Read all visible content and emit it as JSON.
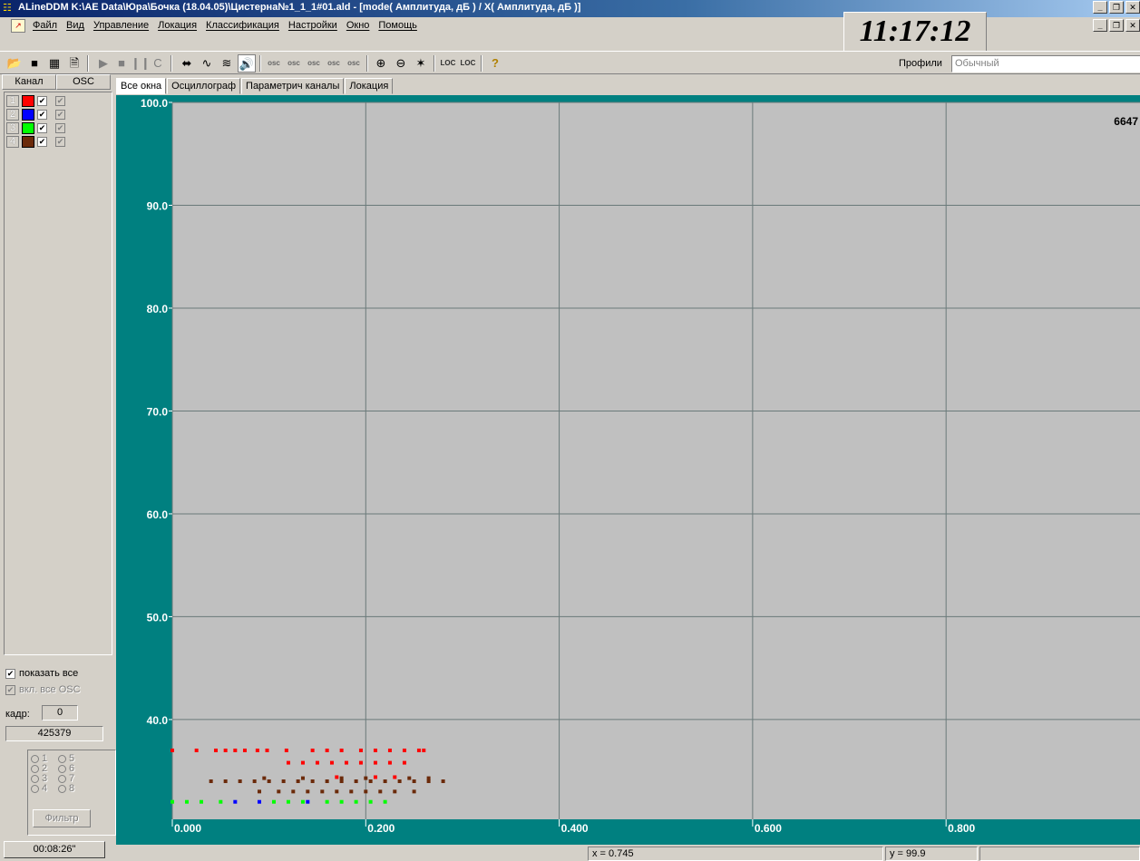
{
  "window": {
    "title": "ALineDDM K:\\AE Data\\Юра\\Бочка (18.04.05)\\Цистерна№1_1_1#01.ald - [mode( Амплитуда, дБ ) / X( Амплитуда, дБ )]",
    "icon": "app-logo-icon"
  },
  "menu": [
    "Файл",
    "Вид",
    "Управление",
    "Локация",
    "Классификация",
    "Настройки",
    "Окно",
    "Помощь"
  ],
  "clock": "11:17:12",
  "toolbar": {
    "profiles_label": "Профили",
    "profiles_value": "Обычный",
    "buttons": [
      "open-icon",
      "stop-square-icon",
      "table-icon",
      "document-icon",
      "play-icon",
      "stop-icon",
      "pause-icon",
      "c-icon",
      "plug-icon",
      "waveform-icon",
      "waveform-filter-icon",
      "speaker-icon",
      "osc-play-icon",
      "osc-stop-icon",
      "osc-record-icon",
      "osc-back-icon",
      "osc-forward-icon",
      "zoom-in-icon",
      "zoom-out-icon",
      "pin-icon",
      "loc-check-icon",
      "loc-refresh-icon",
      "help-icon"
    ],
    "osc_label": "osc",
    "loc_label": "LOC"
  },
  "left_panel": {
    "header_channel": "Канал",
    "header_osc": "OSC",
    "channels": [
      {
        "num": "1",
        "color": "#ff0000"
      },
      {
        "num": "2",
        "color": "#0000ff"
      },
      {
        "num": "3",
        "color": "#00ff00"
      },
      {
        "num": "4",
        "color": "#6b2a0a"
      }
    ],
    "show_all": "показать все",
    "enable_all_osc": "вкл. все OSC",
    "kadr_label": "кадр:",
    "kadr_value": "0",
    "count_value": "425379",
    "radios": [
      "1",
      "2",
      "3",
      "4",
      "5",
      "6",
      "7",
      "8"
    ],
    "filter_button": "Фильтр",
    "elapsed": "00:08:26\""
  },
  "tabs": [
    "Все окна",
    "Осциллограф",
    "Параметрич каналы",
    "Локация"
  ],
  "chart_data": {
    "type": "scatter",
    "count_label": "6647",
    "x_ticks": [
      "0.000",
      "0.200",
      "0.400",
      "0.600",
      "0.800"
    ],
    "y_ticks": [
      "100.0",
      "90.0",
      "80.0",
      "70.0",
      "60.0",
      "50.0",
      "40.0"
    ],
    "xlim": [
      0,
      1.0
    ],
    "ylim": [
      30.3,
      100.0
    ],
    "grid": true,
    "background": "#c0c0c0",
    "series": [
      {
        "color": "#ff0000",
        "points": [
          [
            0.0,
            37.0
          ],
          [
            0.025,
            37.0
          ],
          [
            0.045,
            37.0
          ],
          [
            0.055,
            37.0
          ],
          [
            0.065,
            37.0
          ],
          [
            0.075,
            37.0
          ],
          [
            0.088,
            37.0
          ],
          [
            0.098,
            37.0
          ],
          [
            0.118,
            37.0
          ],
          [
            0.145,
            37.0
          ],
          [
            0.16,
            37.0
          ],
          [
            0.175,
            37.0
          ],
          [
            0.195,
            37.0
          ],
          [
            0.21,
            37.0
          ],
          [
            0.225,
            37.0
          ],
          [
            0.24,
            37.0
          ],
          [
            0.255,
            37.0
          ],
          [
            0.26,
            37.0
          ],
          [
            0.12,
            35.8
          ],
          [
            0.135,
            35.8
          ],
          [
            0.15,
            35.8
          ],
          [
            0.165,
            35.8
          ],
          [
            0.18,
            35.8
          ],
          [
            0.195,
            35.8
          ],
          [
            0.21,
            35.8
          ],
          [
            0.225,
            35.8
          ],
          [
            0.24,
            35.8
          ],
          [
            0.17,
            34.4
          ],
          [
            0.21,
            34.4
          ],
          [
            0.23,
            34.4
          ]
        ]
      },
      {
        "color": "#0000ff",
        "points": [
          [
            0.065,
            32.0
          ],
          [
            0.09,
            32.0
          ],
          [
            0.14,
            32.0
          ]
        ]
      },
      {
        "color": "#00ff00",
        "points": [
          [
            0.0,
            32.0
          ],
          [
            0.015,
            32.0
          ],
          [
            0.03,
            32.0
          ],
          [
            0.05,
            32.0
          ],
          [
            0.105,
            32.0
          ],
          [
            0.12,
            32.0
          ],
          [
            0.135,
            32.0
          ],
          [
            0.16,
            32.0
          ],
          [
            0.175,
            32.0
          ],
          [
            0.19,
            32.0
          ],
          [
            0.205,
            32.0
          ],
          [
            0.22,
            32.0
          ]
        ]
      },
      {
        "color": "#6b2a0a",
        "points": [
          [
            0.04,
            34.0
          ],
          [
            0.055,
            34.0
          ],
          [
            0.07,
            34.0
          ],
          [
            0.085,
            34.0
          ],
          [
            0.1,
            34.0
          ],
          [
            0.115,
            34.0
          ],
          [
            0.13,
            34.0
          ],
          [
            0.145,
            34.0
          ],
          [
            0.16,
            34.0
          ],
          [
            0.175,
            34.0
          ],
          [
            0.19,
            34.0
          ],
          [
            0.205,
            34.0
          ],
          [
            0.22,
            34.0
          ],
          [
            0.235,
            34.0
          ],
          [
            0.25,
            34.0
          ],
          [
            0.265,
            34.0
          ],
          [
            0.28,
            34.0
          ],
          [
            0.095,
            34.3
          ],
          [
            0.135,
            34.3
          ],
          [
            0.175,
            34.3
          ],
          [
            0.2,
            34.3
          ],
          [
            0.245,
            34.3
          ],
          [
            0.265,
            34.3
          ],
          [
            0.09,
            33.0
          ],
          [
            0.11,
            33.0
          ],
          [
            0.125,
            33.0
          ],
          [
            0.14,
            33.0
          ],
          [
            0.155,
            33.0
          ],
          [
            0.17,
            33.0
          ],
          [
            0.185,
            33.0
          ],
          [
            0.2,
            33.0
          ],
          [
            0.215,
            33.0
          ],
          [
            0.23,
            33.0
          ],
          [
            0.25,
            33.0
          ]
        ]
      }
    ]
  },
  "status": {
    "x_readout": "x = 0.745",
    "y_readout": "y = 99.9"
  }
}
